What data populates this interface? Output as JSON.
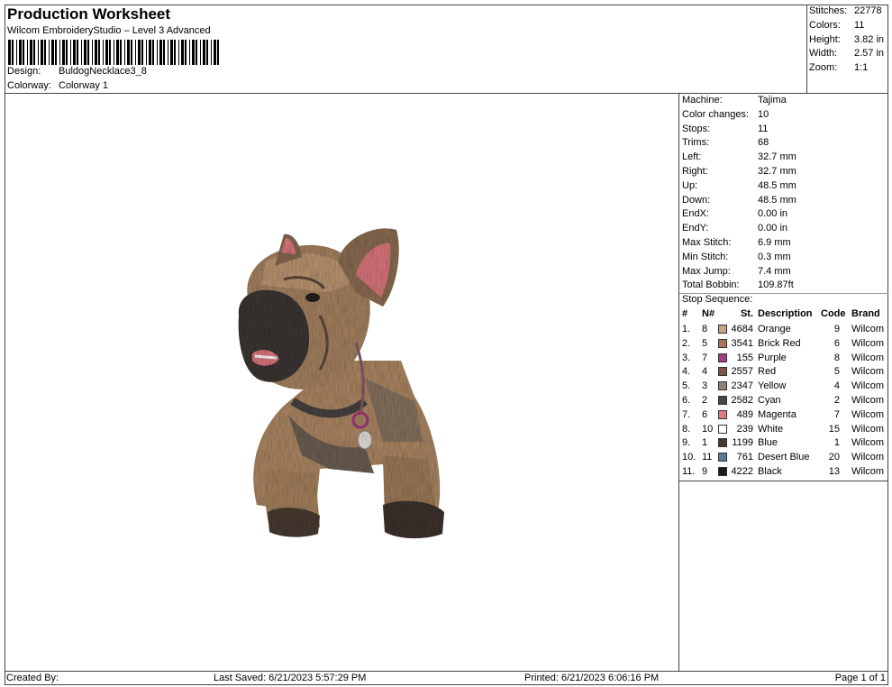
{
  "header": {
    "title": "Production Worksheet",
    "subtitle": "Wilcom EmbroideryStudio – Level 3 Advanced",
    "design_label": "Design:",
    "design_value": "BuldogNecklace3_8",
    "colorway_label": "Colorway:",
    "colorway_value": "Colorway 1"
  },
  "summary": {
    "stitches_label": "Stitches:",
    "stitches": "22778",
    "colors_label": "Colors:",
    "colors": "11",
    "height_label": "Height:",
    "height": "3.82 in",
    "width_label": "Width:",
    "width": "2.57 in",
    "zoom_label": "Zoom:",
    "zoom": "1:1"
  },
  "machine": {
    "rows": [
      {
        "k": "Machine:",
        "v": "Tajima"
      },
      {
        "k": "Color changes:",
        "v": "10"
      },
      {
        "k": "Stops:",
        "v": "11"
      },
      {
        "k": "Trims:",
        "v": "68"
      },
      {
        "k": "Left:",
        "v": "32.7 mm"
      },
      {
        "k": "Right:",
        "v": "32.7 mm"
      },
      {
        "k": "Up:",
        "v": "48.5 mm"
      },
      {
        "k": "Down:",
        "v": "48.5 mm"
      },
      {
        "k": "EndX:",
        "v": "0.00 in"
      },
      {
        "k": "EndY:",
        "v": "0.00 in"
      },
      {
        "k": "Max Stitch:",
        "v": "6.9 mm"
      },
      {
        "k": "Min Stitch:",
        "v": "0.3 mm"
      },
      {
        "k": "Max Jump:",
        "v": "7.4 mm"
      },
      {
        "k": "Total Bobbin:",
        "v": "109.87ft"
      }
    ]
  },
  "stop_sequence": {
    "label": "Stop Sequence:",
    "headers": {
      "num": "#",
      "n": "N#",
      "st": "St.",
      "desc": "Description",
      "code": "Code",
      "brand": "Brand"
    },
    "rows": [
      {
        "num": "1.",
        "n": "8",
        "st": "4684",
        "desc": "Orange",
        "code": "9",
        "brand": "Wilcom",
        "color": "#c8a382"
      },
      {
        "num": "2.",
        "n": "5",
        "st": "3541",
        "desc": "Brick Red",
        "code": "6",
        "brand": "Wilcom",
        "color": "#a87653"
      },
      {
        "num": "3.",
        "n": "7",
        "st": "155",
        "desc": "Purple",
        "code": "8",
        "brand": "Wilcom",
        "color": "#a8397f"
      },
      {
        "num": "4.",
        "n": "4",
        "st": "2557",
        "desc": "Red",
        "code": "5",
        "brand": "Wilcom",
        "color": "#7e5248"
      },
      {
        "num": "5.",
        "n": "3",
        "st": "2347",
        "desc": "Yellow",
        "code": "4",
        "brand": "Wilcom",
        "color": "#8c8279"
      },
      {
        "num": "6.",
        "n": "2",
        "st": "2582",
        "desc": "Cyan",
        "code": "2",
        "brand": "Wilcom",
        "color": "#4a4442"
      },
      {
        "num": "7.",
        "n": "6",
        "st": "489",
        "desc": "Magenta",
        "code": "7",
        "brand": "Wilcom",
        "color": "#e07a80"
      },
      {
        "num": "8.",
        "n": "10",
        "st": "239",
        "desc": "White",
        "code": "15",
        "brand": "Wilcom",
        "color": "#ffffff"
      },
      {
        "num": "9.",
        "n": "1",
        "st": "1199",
        "desc": "Blue",
        "code": "1",
        "brand": "Wilcom",
        "color": "#4a3534"
      },
      {
        "num": "10.",
        "n": "11",
        "st": "761",
        "desc": "Desert Blue",
        "code": "20",
        "brand": "Wilcom",
        "color": "#5b7a9a"
      },
      {
        "num": "11.",
        "n": "9",
        "st": "4222",
        "desc": "Black",
        "code": "13",
        "brand": "Wilcom",
        "color": "#1f1a18"
      }
    ]
  },
  "footer": {
    "created_by": "Created By:",
    "last_saved": "Last Saved: 6/21/2023 5:57:29 PM",
    "printed": "Printed: 6/21/2023 6:06:16 PM",
    "page": "Page 1 of 1"
  }
}
